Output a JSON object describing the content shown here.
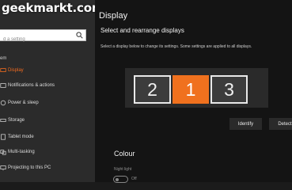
{
  "watermark": "geekmarkt.com",
  "sidebar": {
    "search_placeholder": "d a setting",
    "section": "em",
    "items": [
      {
        "label": "Display",
        "icon": "display-icon",
        "active": true
      },
      {
        "label": "Notifications & actions",
        "icon": "notifications-icon",
        "active": false
      },
      {
        "label": "Power & sleep",
        "icon": "power-icon",
        "active": false
      },
      {
        "label": "Storage",
        "icon": "storage-icon",
        "active": false
      },
      {
        "label": "Tablet mode",
        "icon": "tablet-icon",
        "active": false
      },
      {
        "label": "Multi-tasking",
        "icon": "multitasking-icon",
        "active": false
      },
      {
        "label": "Projecting to this PC",
        "icon": "projecting-icon",
        "active": false
      }
    ]
  },
  "main": {
    "title": "Display",
    "subtitle": "Select and rearrange displays",
    "description": "Select a display below to change its settings. Some settings are applied to all displays.",
    "monitors": [
      "2",
      "1",
      "3"
    ],
    "identify_label": "Identify",
    "detect_label": "Detect",
    "colour_heading": "Colour",
    "night_light_label": "Night light",
    "night_light_state": "Off"
  },
  "colors": {
    "accent": "#f0711e",
    "sidebar_bg": "#2b2b2b",
    "main_bg": "#141414"
  }
}
